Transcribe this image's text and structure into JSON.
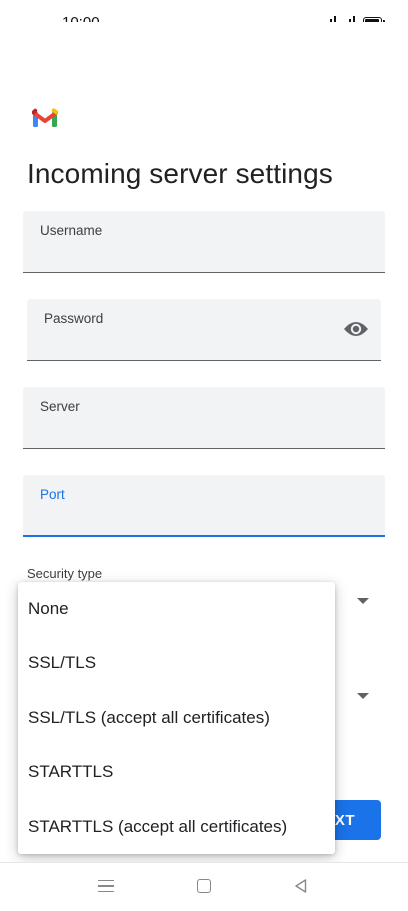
{
  "status_bar": {
    "time": "10:00"
  },
  "header": {
    "title": "Incoming server settings"
  },
  "fields": {
    "username": {
      "label": "Username",
      "value": ""
    },
    "password": {
      "label": "Password",
      "value": ""
    },
    "server": {
      "label": "Server",
      "value": ""
    },
    "port": {
      "label": "Port",
      "value": ""
    }
  },
  "security": {
    "label": "Security type"
  },
  "menu": {
    "items": [
      "None",
      "SSL/TLS",
      "SSL/TLS (accept all certificates)",
      "STARTTLS",
      "STARTTLS (accept all certificates)"
    ]
  },
  "footer": {
    "next_label": "XT"
  },
  "colors": {
    "accent": "#1a73e8",
    "field_bg": "#f1f3f4",
    "gmail_red": "#ea4335",
    "gmail_blue": "#4285f4",
    "gmail_green": "#34a853",
    "gmail_yellow": "#fbbc04"
  },
  "icons": [
    "gmail-logo",
    "eye-icon",
    "chevron-down-icon",
    "nav-recents-icon",
    "nav-home-icon",
    "nav-back-icon"
  ]
}
